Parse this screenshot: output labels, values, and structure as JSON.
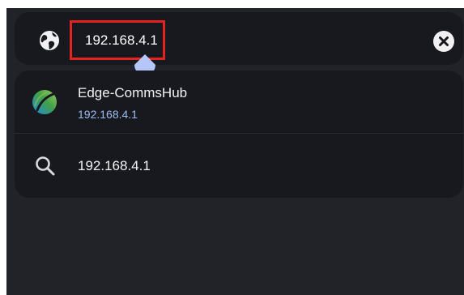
{
  "omnibox": {
    "url": "192.168.4.1",
    "leading_icon": "globe-icon",
    "clear_icon": "close-icon"
  },
  "suggestions": [
    {
      "icon": "site-logo",
      "title": "Edge-CommsHub",
      "url": "192.168.4.1"
    },
    {
      "icon": "search-icon",
      "query": "192.168.4.1"
    }
  ],
  "colors": {
    "screen_bg": "#222329",
    "card_bg": "#18191e",
    "highlight": "#e3231f",
    "link_blue": "#9dbcf3",
    "cursor_handle": "#b6c6f8"
  }
}
